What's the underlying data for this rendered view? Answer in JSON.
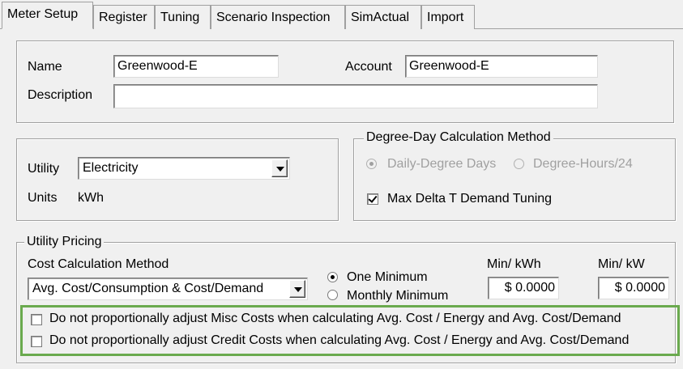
{
  "tabs": [
    {
      "label": "Meter Setup",
      "active": true
    },
    {
      "label": "Register",
      "active": false
    },
    {
      "label": "Tuning",
      "active": false
    },
    {
      "label": "Scenario Inspection",
      "active": false
    },
    {
      "label": "SimActual",
      "active": false
    },
    {
      "label": "Import",
      "active": false
    }
  ],
  "meter": {
    "name_label": "Name",
    "name_value": "Greenwood-E",
    "account_label": "Account",
    "account_value": "Greenwood-E",
    "description_label": "Description",
    "description_value": ""
  },
  "utility": {
    "utility_label": "Utility",
    "utility_value": "Electricity",
    "units_label": "Units",
    "units_value": "kWh"
  },
  "degree_day": {
    "legend": "Degree-Day Calculation Method",
    "option_daily": "Daily-Degree Days",
    "option_hours": "Degree-Hours/24",
    "max_delta_label": "Max Delta T Demand Tuning",
    "max_delta_checked": true
  },
  "pricing": {
    "legend": "Utility Pricing",
    "cost_method_label": "Cost Calculation Method",
    "cost_method_value": "Avg. Cost/Consumption & Cost/Demand",
    "option_one_min": "One Minimum",
    "option_monthly_min": "Monthly Minimum",
    "min_kwh_label": "Min/ kWh",
    "min_kwh_value": "$ 0.0000",
    "min_kw_label": "Min/ kW",
    "min_kw_value": "$ 0.0000",
    "misc_costs_label": "Do not proportionally adjust Misc Costs when calculating Avg. Cost / Energy and Avg. Cost/Demand",
    "credit_costs_label": "Do not proportionally adjust Credit Costs when calculating Avg. Cost / Energy and Avg. Cost/Demand"
  },
  "colors": {
    "highlight": "#6aaa4e",
    "background": "#f0f0f0"
  }
}
